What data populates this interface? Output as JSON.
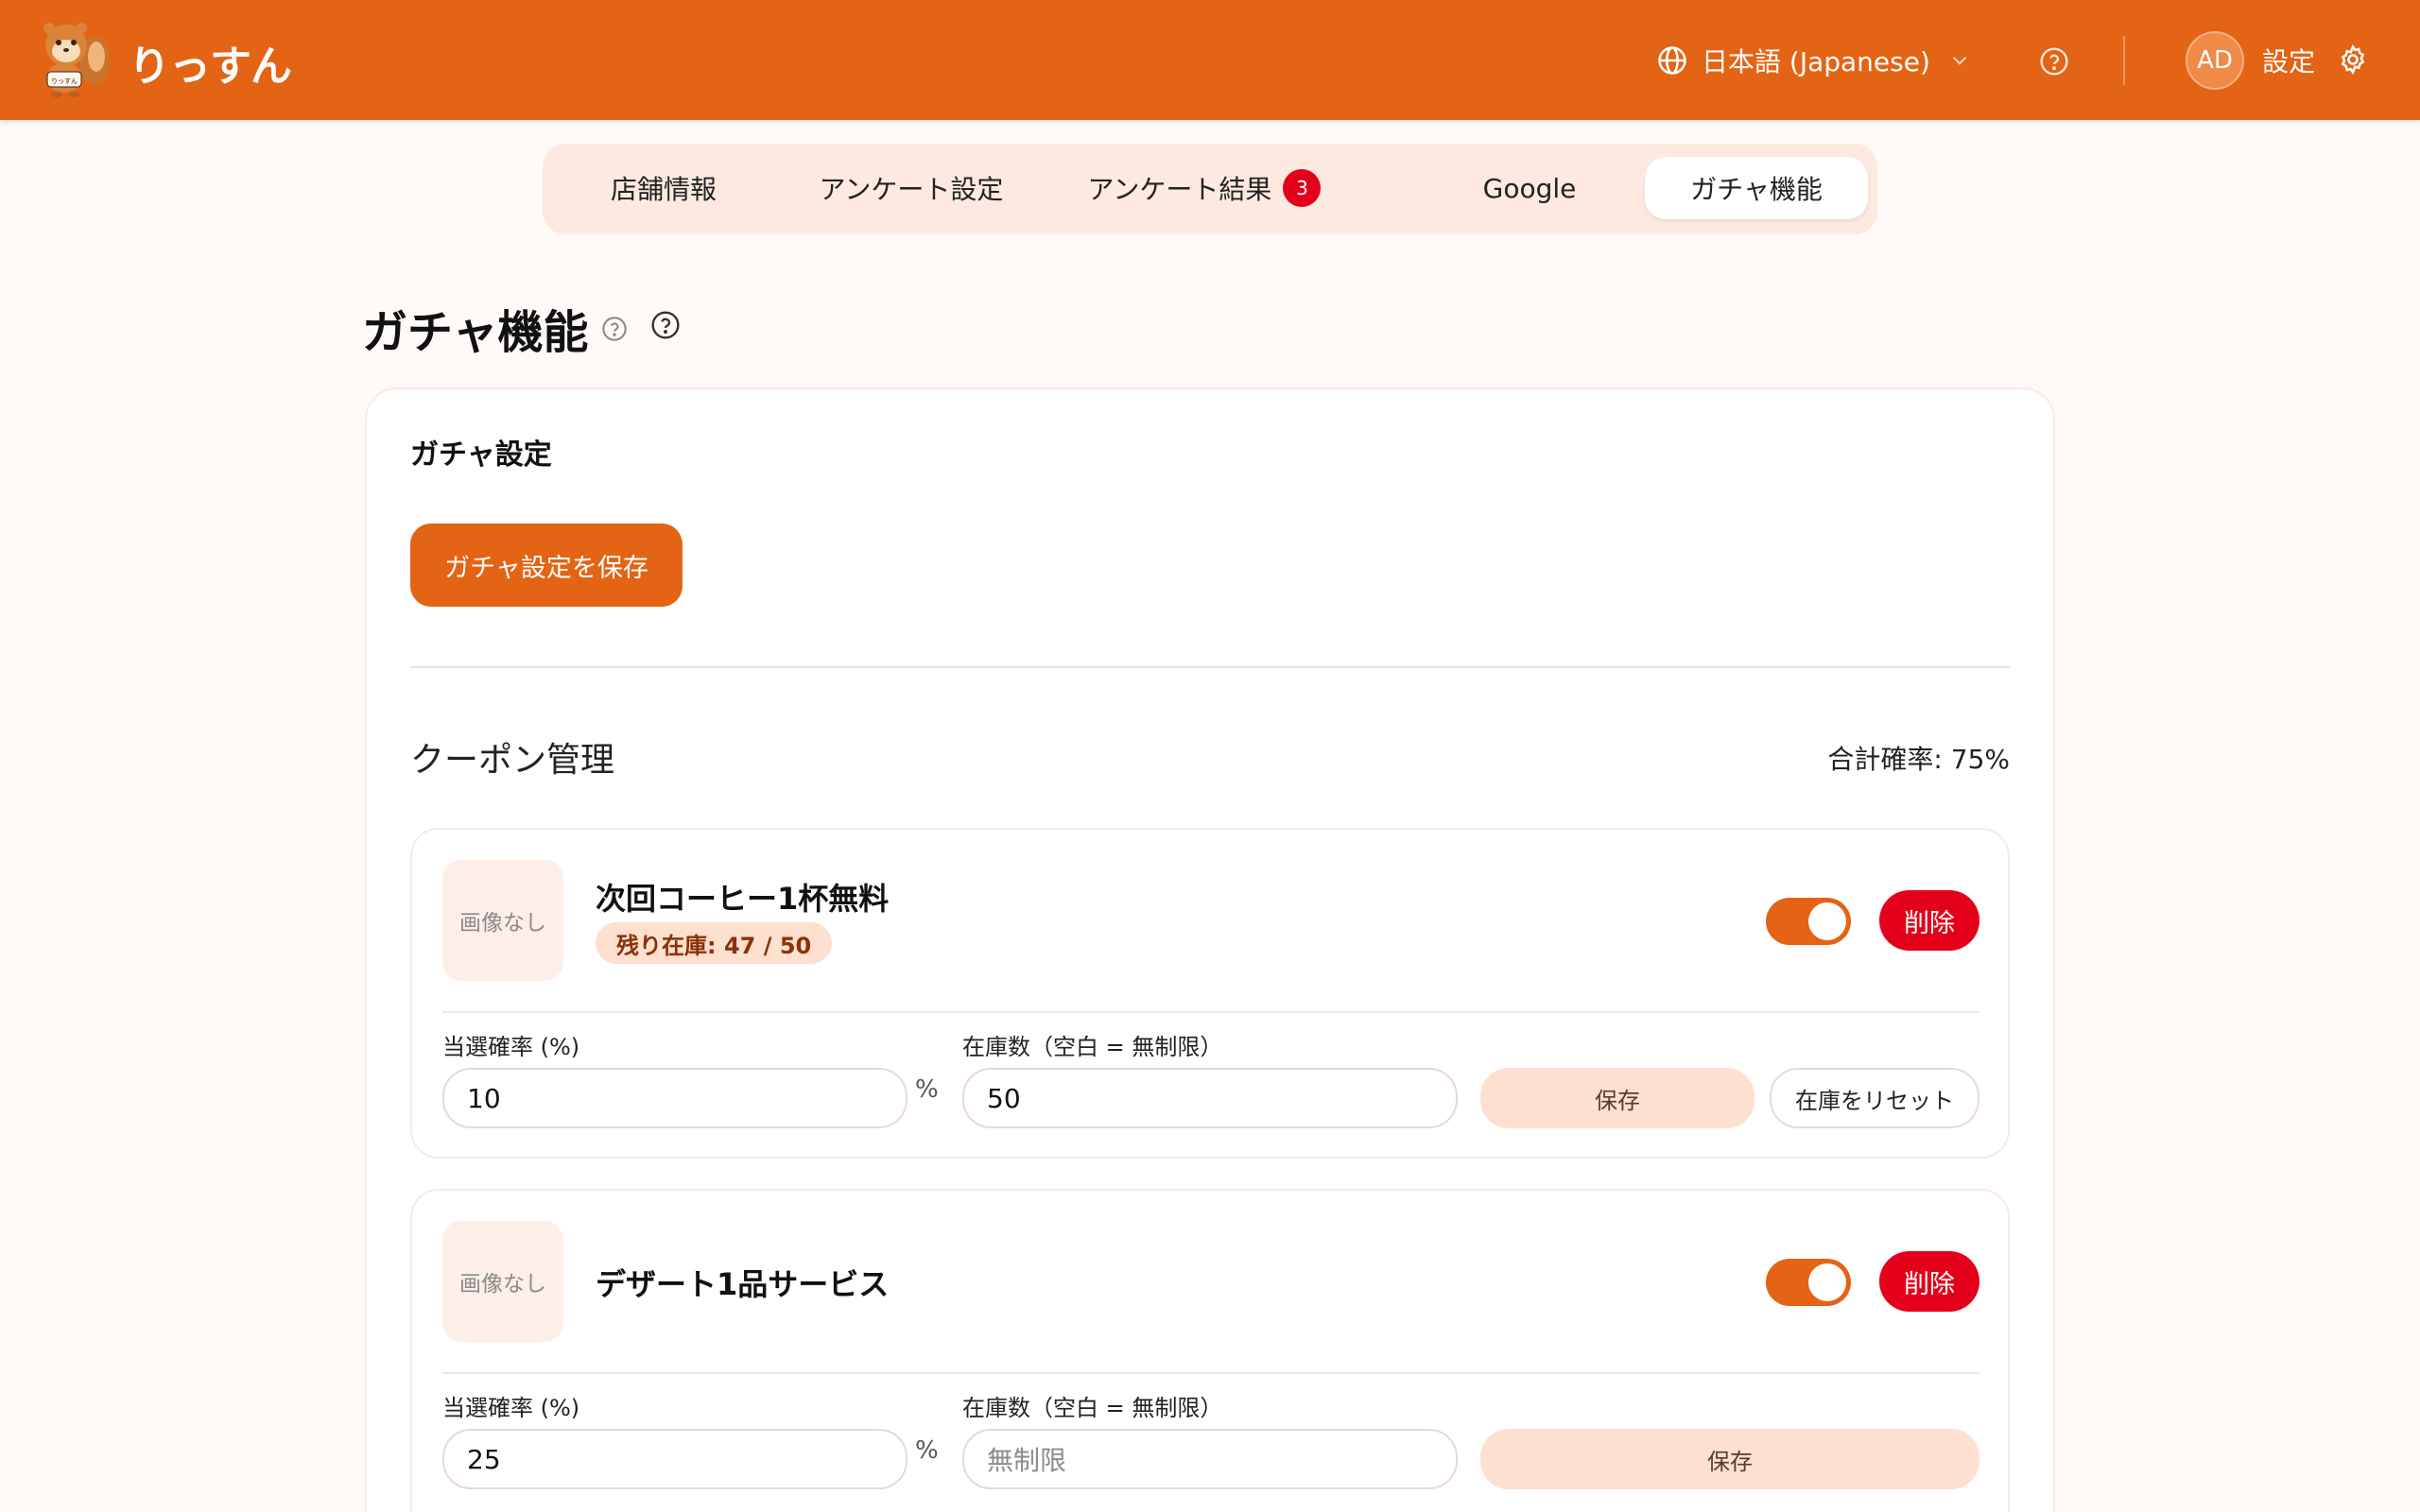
{
  "header": {
    "logo_text": "りっすん",
    "mascot_tag": "りっすん",
    "language": "日本語 (Japanese)",
    "avatar_initials": "AD",
    "settings_label": "設定"
  },
  "tabs": [
    {
      "label": "店舗情報"
    },
    {
      "label": "アンケート設定"
    },
    {
      "label": "アンケート結果",
      "badge": "3"
    },
    {
      "label": "Google"
    },
    {
      "label": "ガチャ機能",
      "active": true
    }
  ],
  "page": {
    "title": "ガチャ機能"
  },
  "gacha_settings": {
    "title": "ガチャ設定",
    "save_label": "ガチャ設定を保存"
  },
  "coupon_management": {
    "title": "クーポン管理",
    "total_rate": "合計確率: 75%",
    "coupons": [
      {
        "thumb": "画像なし",
        "name": "次回コーヒー1杯無料",
        "stock_badge": "残り在庫: 47 / 50",
        "enabled": true,
        "delete_label": "削除",
        "rate_label": "当選確率 (%)",
        "rate_value": "10",
        "percent_sign": "%",
        "stock_label": "在庫数（空白 = 無制限）",
        "stock_value": "50",
        "save_label": "保存",
        "reset_label": "在庫をリセット"
      },
      {
        "thumb": "画像なし",
        "name": "デザート1品サービス",
        "enabled": true,
        "delete_label": "削除",
        "rate_label": "当選確率 (%)",
        "rate_value": "25",
        "percent_sign": "%",
        "stock_label": "在庫数（空白 = 無制限）",
        "stock_placeholder": "無制限",
        "save_label": "保存"
      }
    ]
  },
  "colors": {
    "brand": "#e36414",
    "danger": "#e4001b",
    "soft": "#fde0cf"
  }
}
